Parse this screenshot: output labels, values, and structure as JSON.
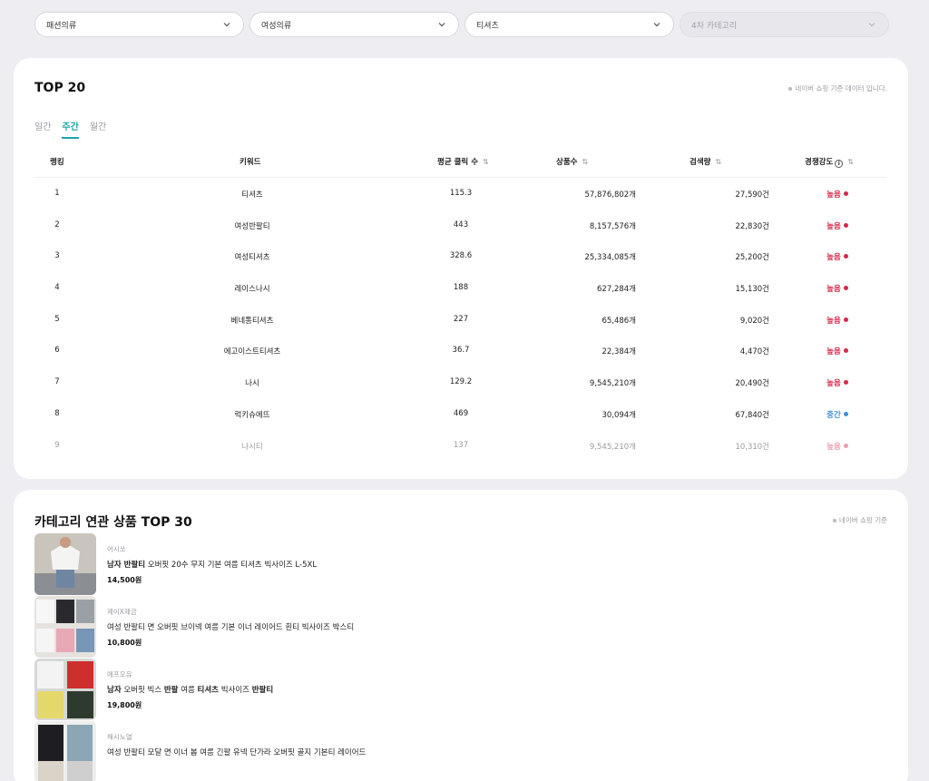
{
  "filters": [
    {
      "label": "패션의류",
      "disabled": false
    },
    {
      "label": "여성의류",
      "disabled": false
    },
    {
      "label": "티셔츠",
      "disabled": false
    },
    {
      "label": "4차 카테고리",
      "disabled": true
    }
  ],
  "top20": {
    "title": "TOP 20",
    "note": "네이버 쇼핑 기준 데이터 입니다.",
    "tabs": [
      "일간",
      "주간",
      "월간"
    ],
    "active_tab": "주간",
    "headers": {
      "rank": "랭킹",
      "keyword": "키워드",
      "avg_click": "평균 클릭 수",
      "products": "상품수",
      "search": "검색량",
      "competition": "경쟁강도"
    },
    "sort_icon": "⇅",
    "rows": [
      {
        "rank": "1",
        "keyword": "티셔츠",
        "avg_click": "115.3",
        "products": "57,876,802개",
        "search": "27,590건",
        "competition": "높음",
        "level": "high"
      },
      {
        "rank": "2",
        "keyword": "여성반팔티",
        "avg_click": "443",
        "products": "8,157,576개",
        "search": "22,830건",
        "competition": "높음",
        "level": "high"
      },
      {
        "rank": "3",
        "keyword": "여성티셔츠",
        "avg_click": "328.6",
        "products": "25,334,085개",
        "search": "25,200건",
        "competition": "높음",
        "level": "high"
      },
      {
        "rank": "4",
        "keyword": "레이스나시",
        "avg_click": "188",
        "products": "627,284개",
        "search": "15,130건",
        "competition": "높음",
        "level": "high"
      },
      {
        "rank": "5",
        "keyword": "베네통티셔츠",
        "avg_click": "227",
        "products": "65,486개",
        "search": "9,020건",
        "competition": "높음",
        "level": "high"
      },
      {
        "rank": "6",
        "keyword": "에고이스트티셔츠",
        "avg_click": "36.7",
        "products": "22,384개",
        "search": "4,470건",
        "competition": "높음",
        "level": "high"
      },
      {
        "rank": "7",
        "keyword": "나시",
        "avg_click": "129.2",
        "products": "9,545,210개",
        "search": "20,490건",
        "competition": "높음",
        "level": "high"
      },
      {
        "rank": "8",
        "keyword": "럭키슈에뜨",
        "avg_click": "469",
        "products": "30,094개",
        "search": "67,840건",
        "competition": "중간",
        "level": "mid"
      },
      {
        "rank": "9",
        "keyword": "나시티",
        "avg_click": "137",
        "products": "9,545,210개",
        "search": "10,310건",
        "competition": "높음",
        "level": "high"
      }
    ]
  },
  "top30": {
    "title": "카테고리 연관 상품 TOP 30",
    "note": "네이버 쇼핑 기준",
    "products": [
      {
        "seller": "어시쏘",
        "name_parts": [
          {
            "t": "남자 반팔티",
            "b": true
          },
          {
            "t": " 오버핏 20수 무지 기본 여름 티셔츠 빅사이즈 L-5XL",
            "b": false
          }
        ],
        "price": "14,500원"
      },
      {
        "seller": "제이X제금",
        "name_parts": [
          {
            "t": "여성 반팔티 면 오버핏 브이넥 여름 기본 이너 레이어드 흰티 빅사이즈 박스티",
            "b": false
          }
        ],
        "price": "10,800원"
      },
      {
        "seller": "에프오유",
        "name_parts": [
          {
            "t": "남자",
            "b": true
          },
          {
            "t": " 오버핏 빅스 ",
            "b": false
          },
          {
            "t": "반팔",
            "b": true
          },
          {
            "t": " 여름 ",
            "b": false
          },
          {
            "t": "티셔츠",
            "b": true
          },
          {
            "t": " 빅사이즈 ",
            "b": false
          },
          {
            "t": "반팔티",
            "b": true
          }
        ],
        "price": "19,800원"
      },
      {
        "seller": "해시노열",
        "name_parts": [
          {
            "t": "여성 반팔티 모달 면 이너 봄 여름 긴팔 유넥 단가라 오버핏 골지 기본티 레이어드",
            "b": false
          }
        ],
        "price": ""
      }
    ]
  },
  "colors": {
    "accent": "#1aa6a6",
    "high": "#d6284a",
    "mid": "#3d8fd4"
  }
}
